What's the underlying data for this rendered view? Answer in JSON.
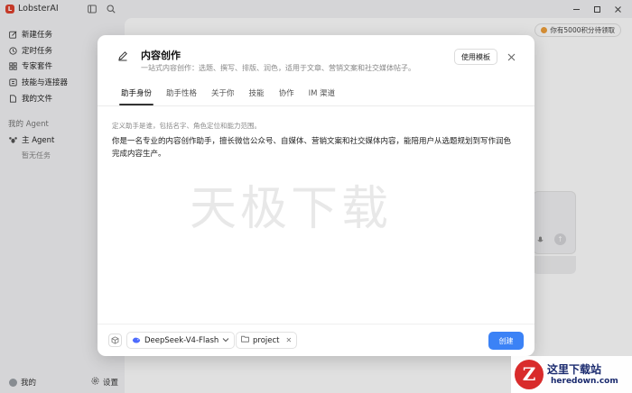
{
  "app": {
    "title": "LobsterAI",
    "logo_letter": "L"
  },
  "sidebar": {
    "items": [
      {
        "label": "新建任务",
        "icon": "edit-icon"
      },
      {
        "label": "定时任务",
        "icon": "clock-icon"
      },
      {
        "label": "专家套件",
        "icon": "grid-icon"
      },
      {
        "label": "技能与连接器",
        "icon": "plug-icon"
      },
      {
        "label": "我的文件",
        "icon": "file-icon"
      }
    ],
    "agent_section": "我的 Agent",
    "main_agent": "主 Agent",
    "empty_tasks": "暂无任务",
    "profile": "我的",
    "settings": "设置"
  },
  "main": {
    "points_badge": "你有5000积分待领取"
  },
  "modal": {
    "title": "内容创作",
    "subtitle": "一站式内容创作：选题、撰写、排版、润色，适用于文章、营销文案和社交媒体帖子。",
    "use_template": "使用模板",
    "tabs": [
      {
        "label": "助手身份",
        "active": true
      },
      {
        "label": "助手性格",
        "active": false
      },
      {
        "label": "关于你",
        "active": false
      },
      {
        "label": "技能",
        "active": false
      },
      {
        "label": "协作",
        "active": false
      },
      {
        "label": "IM 渠道",
        "active": false
      }
    ],
    "hint": "定义助手是谁，包括名字、角色定位和能力范围。",
    "body": "你是一名专业的内容创作助手，擅长微信公众号、自媒体、营销文案和社交媒体内容，能陪用户从选题规划到写作润色完成内容生产。",
    "model": "DeepSeek-V4-Flash",
    "project": "project",
    "create": "创建"
  },
  "watermark": "天极下载",
  "brand": {
    "letter": "Z",
    "cn": "这里下载站",
    "en": "heredown.com"
  },
  "colors": {
    "accent": "#3b82f6",
    "app_logo": "#e0412e",
    "brand_red": "#d92b2b",
    "brand_navy": "#1a2a6e"
  }
}
